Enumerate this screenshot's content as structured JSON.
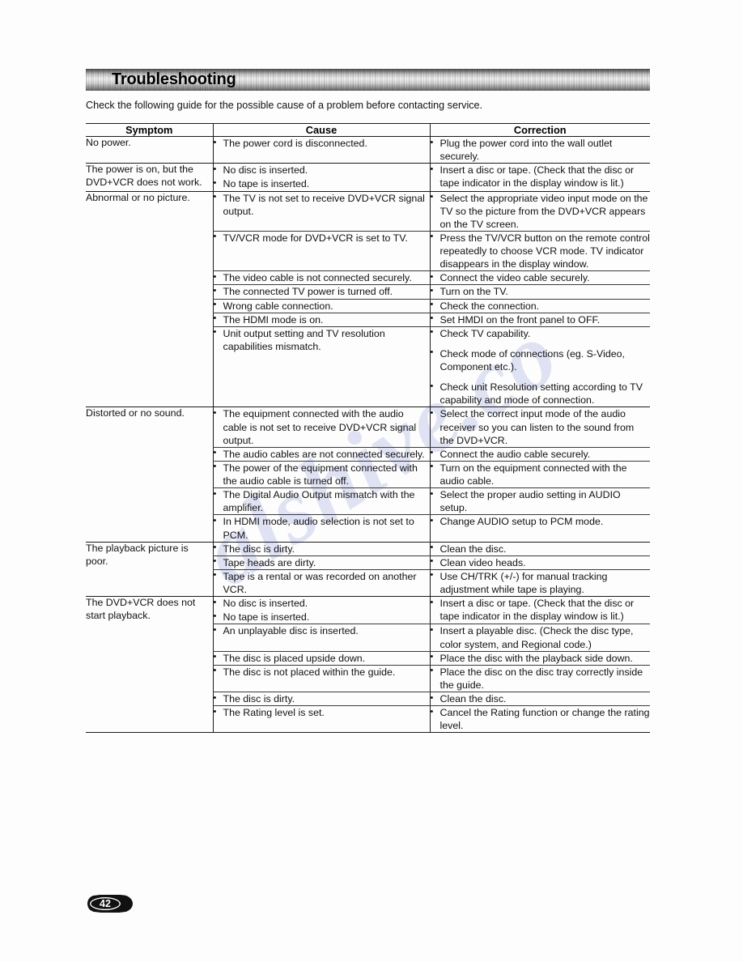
{
  "document": {
    "title": "Troubleshooting",
    "intro": "Check the following guide for the possible cause of a problem before contacting service.",
    "page_number": "42"
  },
  "watermark": {
    "text": "alshive.co"
  },
  "table": {
    "headers": {
      "symptom": "Symptom",
      "cause": "Cause",
      "correction": "Correction"
    },
    "groups": [
      {
        "symptom": "No power.",
        "rows": [
          {
            "causes": [
              "The power cord is disconnected."
            ],
            "corrections": [
              "Plug the power cord into the wall outlet securely."
            ]
          }
        ]
      },
      {
        "symptom": "The power is on, but the DVD+VCR does not work.",
        "rows": [
          {
            "causes": [
              "No disc is inserted.",
              "No tape is inserted."
            ],
            "corrections": [
              "Insert a disc or tape. (Check that the disc or tape indicator in the display window is lit.)"
            ]
          }
        ]
      },
      {
        "symptom": "Abnormal or no picture.",
        "rows": [
          {
            "causes": [
              "The TV is not set to receive DVD+VCR signal output."
            ],
            "corrections": [
              "Select the appropriate video input mode on the TV so the picture from the DVD+VCR appears on the TV screen."
            ]
          },
          {
            "causes": [
              "TV/VCR mode for DVD+VCR is set to TV."
            ],
            "corrections": [
              "Press the TV/VCR button on the remote control repeatedly to choose VCR mode. TV indicator disappears in the display window."
            ]
          },
          {
            "causes": [
              "The video cable is not connected securely."
            ],
            "corrections": [
              "Connect the video cable securely."
            ]
          },
          {
            "causes": [
              "The connected TV power is turned off."
            ],
            "corrections": [
              "Turn on the TV."
            ]
          },
          {
            "causes": [
              "Wrong cable connection."
            ],
            "corrections": [
              "Check the connection."
            ]
          },
          {
            "causes": [
              "The HDMI mode is on."
            ],
            "corrections": [
              "Set HMDI on the front panel to OFF."
            ]
          },
          {
            "causes": [
              "Unit output setting and TV resolution capabilities mismatch."
            ],
            "corrections": [
              "Check TV capability.",
              "Check mode of connections (eg. S-Video, Component etc.).",
              "Check unit Resolution setting according to TV capability and mode of connection."
            ]
          }
        ]
      },
      {
        "symptom": "Distorted or no sound.",
        "rows": [
          {
            "causes": [
              "The equipment connected with the audio cable is not set to receive DVD+VCR signal output."
            ],
            "corrections": [
              "Select the correct input mode of the audio receiver so you can listen to the sound from the DVD+VCR."
            ]
          },
          {
            "causes": [
              "The audio cables are not connected securely."
            ],
            "corrections": [
              "Connect the audio cable securely."
            ]
          },
          {
            "causes": [
              "The power of the equipment connected with the audio cable is turned off."
            ],
            "corrections": [
              "Turn on the equipment connected with the audio cable."
            ]
          },
          {
            "causes": [
              "The Digital Audio Output mismatch with the amplifier."
            ],
            "corrections": [
              "Select the proper audio setting in AUDIO setup."
            ]
          },
          {
            "causes": [
              "In HDMI mode, audio selection is not set to PCM."
            ],
            "corrections": [
              "Change AUDIO setup to PCM mode."
            ]
          }
        ]
      },
      {
        "symptom": "The playback picture is poor.",
        "rows": [
          {
            "causes": [
              "The disc is dirty."
            ],
            "corrections": [
              "Clean the disc."
            ]
          },
          {
            "causes": [
              "Tape heads are dirty."
            ],
            "corrections": [
              "Clean video heads."
            ]
          },
          {
            "causes": [
              "Tape is a rental or was recorded on another VCR."
            ],
            "corrections": [
              "Use CH/TRK (+/-) for manual tracking adjustment while tape is playing."
            ]
          }
        ]
      },
      {
        "symptom": "The DVD+VCR does not start playback.",
        "rows": [
          {
            "causes": [
              "No disc is inserted.",
              "No tape is inserted."
            ],
            "corrections": [
              "Insert a disc or tape. (Check that the disc or tape indicator in the display window is lit.)"
            ]
          },
          {
            "causes": [
              "An unplayable disc is inserted."
            ],
            "corrections": [
              "Insert a playable disc. (Check the disc type, color system, and Regional code.)"
            ]
          },
          {
            "causes": [
              "The disc is placed upside down."
            ],
            "corrections": [
              "Place the disc with the playback side down."
            ]
          },
          {
            "causes": [
              "The disc is not placed within the guide."
            ],
            "corrections": [
              "Place the disc on the disc tray correctly inside the guide."
            ]
          },
          {
            "causes": [
              "The disc is dirty."
            ],
            "corrections": [
              "Clean the disc."
            ]
          },
          {
            "causes": [
              "The Rating level is set."
            ],
            "corrections": [
              "Cancel the Rating function or change the rating  level."
            ]
          }
        ]
      }
    ]
  }
}
